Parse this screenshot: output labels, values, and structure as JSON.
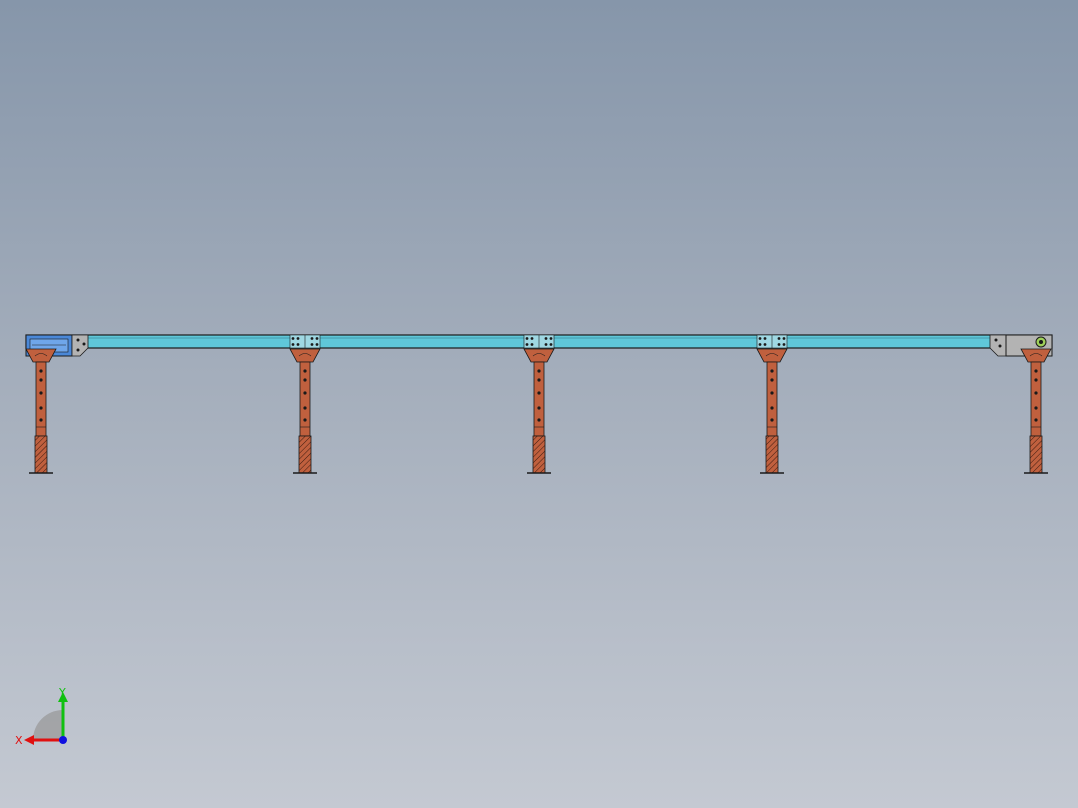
{
  "colors": {
    "beam": "#5fc7d9",
    "leg": "#c0603e",
    "end_plate": "#b3b3b3",
    "motor": "#4a88d8",
    "outline": "#1a1a1a",
    "axis_x": "#e01010",
    "axis_y": "#10c010",
    "axis_z": "#1010e0"
  },
  "model": {
    "name": "conveyor-frame-front-view",
    "support_count": 5,
    "end_left": "drive-unit",
    "end_right": "idler-unit"
  },
  "triad": {
    "x_label": "X",
    "y_label": "Y"
  },
  "icons": {
    "triad": "coordinate-axes-icon",
    "drive": "motor-icon",
    "idler": "pulley-icon"
  }
}
